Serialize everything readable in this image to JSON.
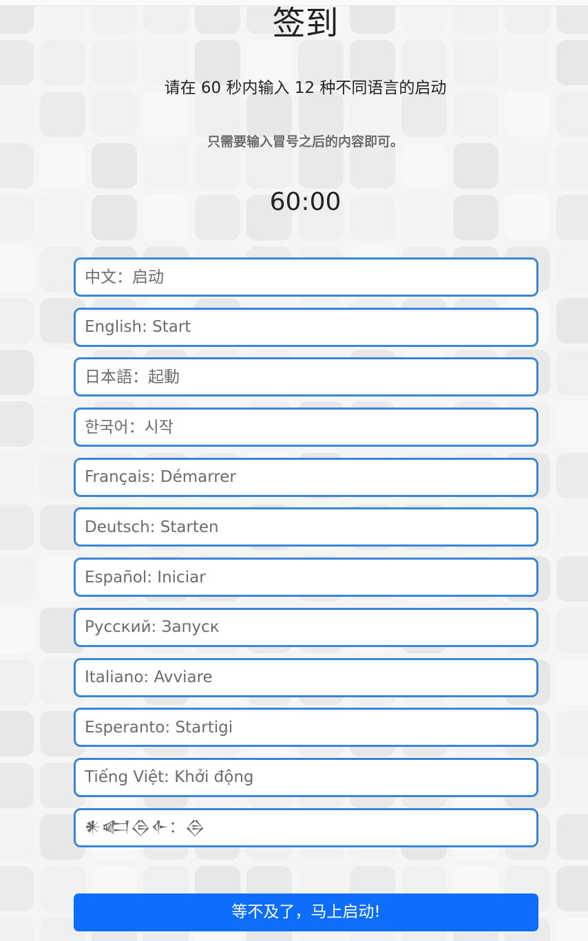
{
  "page": {
    "title": "签到",
    "subtitle": "请在 60 秒内输入 12 种不同语言的启动",
    "hint": "只需要输入冒号之后的内容即可。",
    "timer": "60:00"
  },
  "fields": [
    {
      "placeholder": "中文：启动"
    },
    {
      "placeholder": "English: Start"
    },
    {
      "placeholder": "日本語：起動"
    },
    {
      "placeholder": "한국어：시작"
    },
    {
      "placeholder": "Français: Démarrer"
    },
    {
      "placeholder": "Deutsch: Starten"
    },
    {
      "placeholder": "Español: Iniciar"
    },
    {
      "placeholder": "Русский: Запуск"
    },
    {
      "placeholder": "Italiano: Avviare"
    },
    {
      "placeholder": "Esperanto: Startigi"
    },
    {
      "placeholder": "Tiếng Việt: Khởi động"
    },
    {
      "placeholder": "𒀭𒅗𒁲𒅆：𒁲"
    }
  ],
  "submit_label": "等不及了，马上启动!",
  "colors": {
    "accent": "#0d6efd",
    "field_border": "#3a86d6",
    "background": "#f5f5f5",
    "tile": "#e8e8e8"
  }
}
